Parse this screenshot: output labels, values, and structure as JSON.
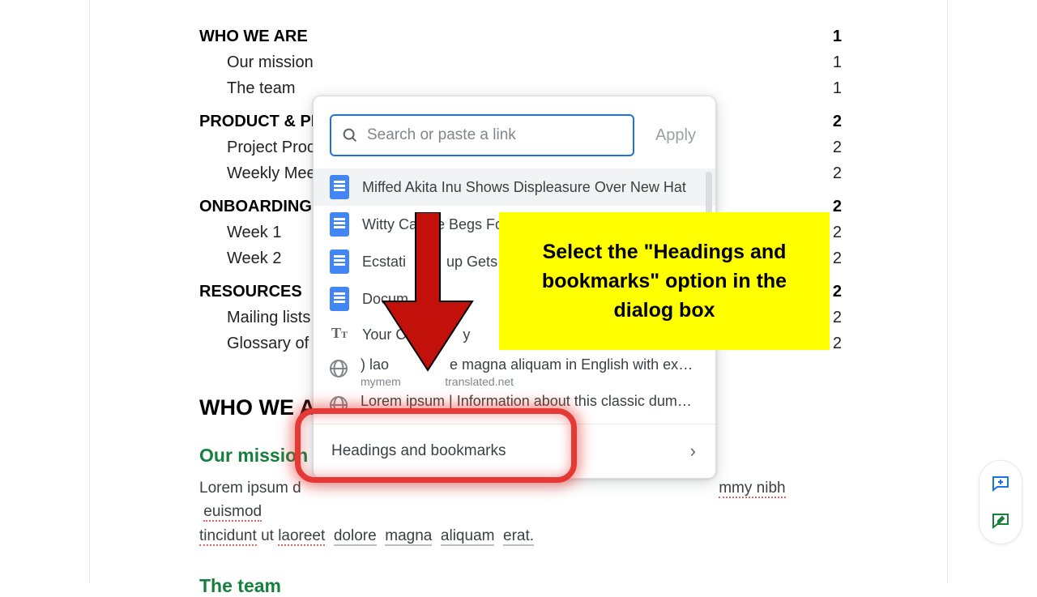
{
  "toc": {
    "s0": {
      "title": "WHO WE ARE",
      "page": "1",
      "items": [
        {
          "label": "Our mission",
          "page": "1"
        },
        {
          "label": "The team",
          "page": "1"
        }
      ]
    },
    "s1": {
      "title": "PRODUCT & PR",
      "page": "2",
      "items": [
        {
          "label": "Project Proc",
          "page": "2"
        },
        {
          "label": "Weekly Mee",
          "page": "2"
        }
      ]
    },
    "s2": {
      "title": "ONBOARDING",
      "page": "2",
      "items": [
        {
          "label": "Week 1",
          "page": "2"
        },
        {
          "label": "Week 2",
          "page": "2"
        }
      ]
    },
    "s3": {
      "title": "RESOURCES",
      "page": "2",
      "items": [
        {
          "label": "Mailing lists",
          "page": "2"
        },
        {
          "label": "Glossary of t",
          "page": "2"
        }
      ]
    }
  },
  "content": {
    "h1": "WHO WE AR",
    "sub1": "Our mission",
    "para_a": "Lorem ipsum d",
    "para_b": "mmy nibh",
    "para_c": "euismod",
    "para2a": "tincidunt",
    "para2b": " ut ",
    "para2c": "laoreet",
    "para2d": "dolore",
    "para2e": "magna",
    "para2f": "aliquam",
    "para2g": "erat.",
    "sub2": "The team"
  },
  "dialog": {
    "placeholder": "Search or paste a link",
    "apply": "Apply",
    "suggestions": {
      "s0": "Miffed Akita Inu Shows Displeasure Over New Hat",
      "s1": "Witty Canine Begs Fo",
      "s2": "Ecstati          up Gets Thr",
      "s3": "Docum",
      "s4": "Your C              y",
      "s5": {
        "title": ") lao               e magna aliquam in English with exa…",
        "sub": "mymem              translated.net"
      },
      "s6": {
        "title": "Lorem ipsum | Information about this classic dumm…",
        "sub": ""
      }
    },
    "headings": "Headings and bookmarks"
  },
  "callout": "Select the \"Headings and bookmarks\" option in the dialog box"
}
